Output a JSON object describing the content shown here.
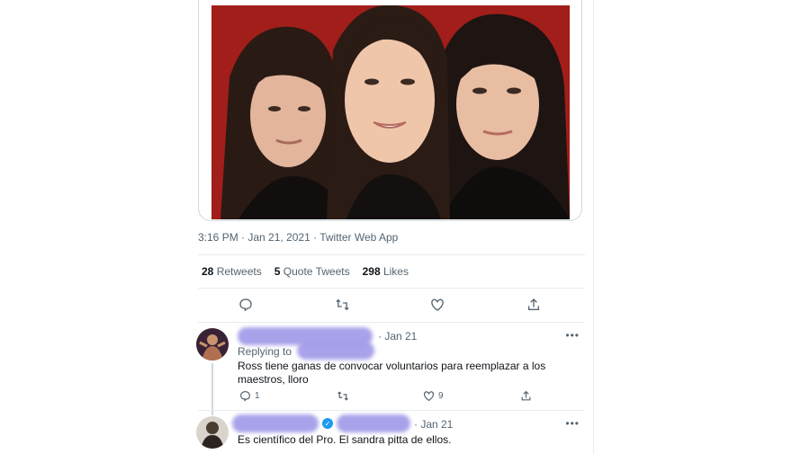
{
  "tweet": {
    "meta": "3:16 PM · Jan 21, 2021 · Twitter Web App",
    "stats": [
      {
        "count": "28",
        "label": "Retweets"
      },
      {
        "count": "5",
        "label": "Quote Tweets"
      },
      {
        "count": "298",
        "label": "Likes"
      }
    ]
  },
  "actions": [
    "reply-icon",
    "retweet-icon",
    "like-icon",
    "share-icon"
  ],
  "replies": [
    {
      "date": "· Jan 21",
      "replying_to": "Replying to",
      "text": "Ross tiene ganas de convocar voluntarios para reemplazar a los maestros, lloro",
      "reply_count": "1",
      "like_count": "9",
      "more": "•••"
    },
    {
      "date": "· Jan 21",
      "text": "Es científico del Pro. El sandra pitta de ellos.",
      "verified": "✓",
      "more": "•••"
    }
  ],
  "colors": {
    "accent": "#1d9bf0",
    "photo_background": "#a11e1a",
    "redaction": "#9f98e8"
  }
}
